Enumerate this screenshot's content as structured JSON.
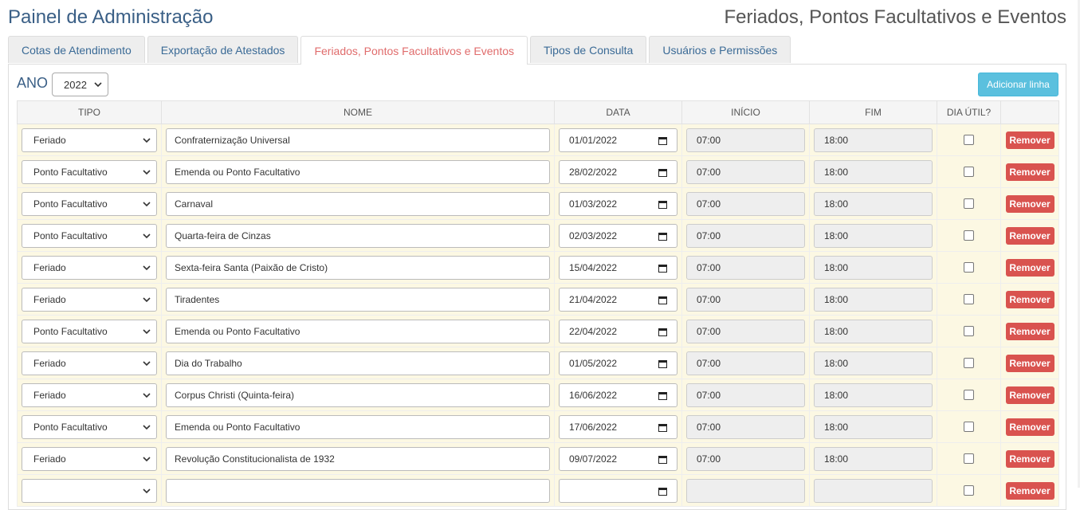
{
  "header": {
    "app_title": "Painel de Administração",
    "section_title": "Feriados, Pontos Facultativos e Eventos"
  },
  "tabs": [
    {
      "label": "Cotas de Atendimento",
      "active": false
    },
    {
      "label": "Exportação de Atestados",
      "active": false
    },
    {
      "label": "Feriados, Pontos Facultativos e Eventos",
      "active": true
    },
    {
      "label": "Tipos de Consulta",
      "active": false
    },
    {
      "label": "Usuários e Permissões",
      "active": false
    }
  ],
  "toolbar": {
    "year_label": "ANO",
    "year_value": "2022",
    "add_label": "Adicionar linha"
  },
  "table": {
    "headers": [
      "TIPO",
      "NOME",
      "DATA",
      "INÍCIO",
      "FIM",
      "DIA ÚTIL?",
      ""
    ],
    "remove_label": "Remover",
    "rows": [
      {
        "tipo": "Feriado",
        "nome": "Confraternização Universal",
        "data": "01/01/2022",
        "inicio": "07:00",
        "fim": "18:00",
        "dia_util": false
      },
      {
        "tipo": "Ponto Facultativo",
        "nome": "Emenda ou Ponto Facultativo",
        "data": "28/02/2022",
        "inicio": "07:00",
        "fim": "18:00",
        "dia_util": false
      },
      {
        "tipo": "Ponto Facultativo",
        "nome": "Carnaval",
        "data": "01/03/2022",
        "inicio": "07:00",
        "fim": "18:00",
        "dia_util": false
      },
      {
        "tipo": "Ponto Facultativo",
        "nome": "Quarta-feira de Cinzas",
        "data": "02/03/2022",
        "inicio": "07:00",
        "fim": "18:00",
        "dia_util": false
      },
      {
        "tipo": "Feriado",
        "nome": "Sexta-feira Santa (Paixão de Cristo)",
        "data": "15/04/2022",
        "inicio": "07:00",
        "fim": "18:00",
        "dia_util": false
      },
      {
        "tipo": "Feriado",
        "nome": "Tiradentes",
        "data": "21/04/2022",
        "inicio": "07:00",
        "fim": "18:00",
        "dia_util": false
      },
      {
        "tipo": "Ponto Facultativo",
        "nome": "Emenda ou Ponto Facultativo",
        "data": "22/04/2022",
        "inicio": "07:00",
        "fim": "18:00",
        "dia_util": false
      },
      {
        "tipo": "Feriado",
        "nome": "Dia do Trabalho",
        "data": "01/05/2022",
        "inicio": "07:00",
        "fim": "18:00",
        "dia_util": false
      },
      {
        "tipo": "Feriado",
        "nome": "Corpus Christi (Quinta-feira)",
        "data": "16/06/2022",
        "inicio": "07:00",
        "fim": "18:00",
        "dia_util": false
      },
      {
        "tipo": "Ponto Facultativo",
        "nome": "Emenda ou Ponto Facultativo",
        "data": "17/06/2022",
        "inicio": "07:00",
        "fim": "18:00",
        "dia_util": false
      },
      {
        "tipo": "Feriado",
        "nome": "Revolução Constitucionalista de 1932",
        "data": "09/07/2022",
        "inicio": "07:00",
        "fim": "18:00",
        "dia_util": false
      },
      {
        "tipo": "",
        "nome": "",
        "data": "",
        "inicio": "",
        "fim": "",
        "dia_util": false
      }
    ]
  },
  "colors": {
    "title": "#3a5f86",
    "tab_active": "#e06c6c",
    "row_bg": "#fcf8e3",
    "add_button": "#5bc0de",
    "remove_button": "#d9534f"
  }
}
